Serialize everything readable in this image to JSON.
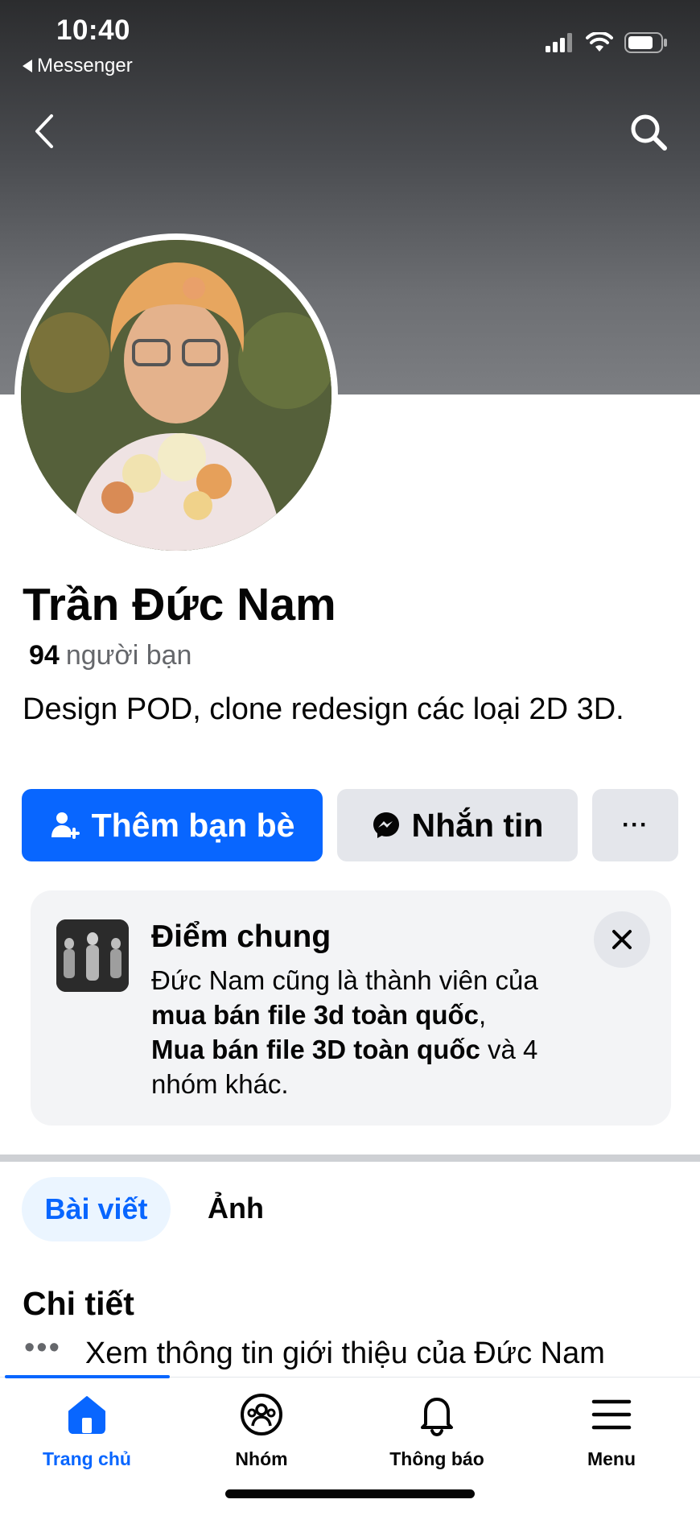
{
  "status_bar": {
    "time": "10:40",
    "back_app": "Messenger"
  },
  "profile": {
    "name": "Trần Đức Nam",
    "friends_count": "94",
    "friends_label": "người bạn",
    "bio": "Design POD, clone redesign các loại 2D 3D."
  },
  "actions": {
    "add_friend": "Thêm bạn bè",
    "message": "Nhắn tin",
    "more": "···"
  },
  "mutual_card": {
    "title": "Điểm chung",
    "line_intro": "Đức Nam cũng là thành viên của",
    "group_1": "mua bán file 3d toàn quốc",
    "group_1_suffix": ",",
    "group_2": "Mua bán file 3D toàn quốc",
    "group_2_suffix": " và 4 nhóm khác."
  },
  "tabs": {
    "posts": "Bài viết",
    "photos": "Ảnh"
  },
  "details": {
    "title": "Chi tiết",
    "intro_link": "Xem thông tin giới thiệu của Đức Nam"
  },
  "bottom_nav": {
    "items": [
      {
        "label": "Trang chủ",
        "icon": "home-icon"
      },
      {
        "label": "Nhóm",
        "icon": "groups-icon"
      },
      {
        "label": "Thông báo",
        "icon": "bell-icon"
      },
      {
        "label": "Menu",
        "icon": "menu-icon"
      }
    ]
  },
  "colors": {
    "accent": "#0866ff",
    "secondary_button": "#e4e6eb",
    "muted_text": "#65676b"
  }
}
